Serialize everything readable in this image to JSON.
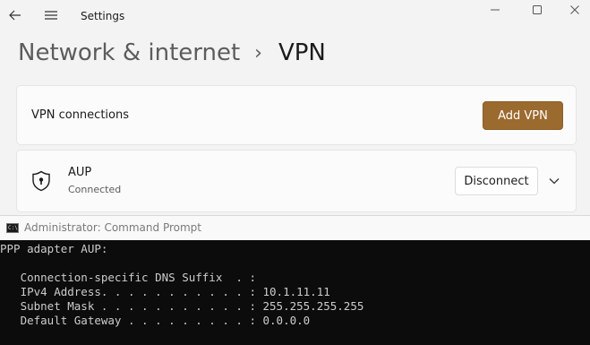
{
  "settings": {
    "title": "Settings",
    "breadcrumb": {
      "parent": "Network & internet",
      "separator": "›",
      "current": "VPN"
    },
    "vpn_connections": {
      "label": "VPN connections",
      "add_button": "Add VPN"
    },
    "connection": {
      "name": "AUP",
      "status": "Connected",
      "disconnect_button": "Disconnect"
    },
    "accent_color": "#9b6a2f"
  },
  "cmd": {
    "title": "Administrator: Command Prompt",
    "lines": [
      "PPP adapter AUP:",
      "",
      "   Connection-specific DNS Suffix  . :",
      "   IPv4 Address. . . . . . . . . . . : 10.1.11.11",
      "   Subnet Mask . . . . . . . . . . . : 255.255.255.255",
      "   Default Gateway . . . . . . . . . : 0.0.0.0"
    ]
  }
}
